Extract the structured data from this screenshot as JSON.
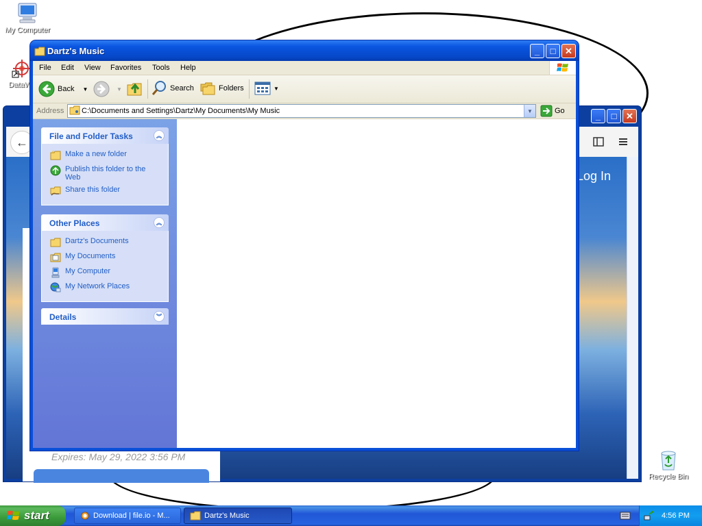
{
  "desktop": {
    "icons": {
      "my_computer": "My Computer",
      "datawarrior": "DataWa",
      "recycle_bin": "Recycle Bin"
    }
  },
  "browser": {
    "login_label": "Log In",
    "expires_text": "Expires: May 29, 2022 3:56 PM"
  },
  "explorer": {
    "title": "Dartz's Music",
    "menu": [
      "File",
      "Edit",
      "View",
      "Favorites",
      "Tools",
      "Help"
    ],
    "toolbar": {
      "back": "Back",
      "search": "Search",
      "folders": "Folders"
    },
    "address": {
      "label": "Address",
      "path": "C:\\Documents and Settings\\Dartz\\My Documents\\My Music",
      "go": "Go"
    },
    "panels": {
      "file_tasks": {
        "title": "File and Folder Tasks",
        "items": [
          "Make a new folder",
          "Publish this folder to the Web",
          "Share this folder"
        ]
      },
      "other_places": {
        "title": "Other Places",
        "items": [
          "Dartz's Documents",
          "My Documents",
          "My Computer",
          "My Network Places"
        ]
      },
      "details": {
        "title": "Details"
      }
    }
  },
  "taskbar": {
    "start_label": "start",
    "tasks": [
      "Download | file.io - M...",
      "Dartz's Music"
    ],
    "clock": "4:56 PM"
  },
  "colors": {
    "xp_title_blue": "#0a55e0",
    "task_pane_link": "#215dc6",
    "start_green": "#3a9a3a"
  }
}
